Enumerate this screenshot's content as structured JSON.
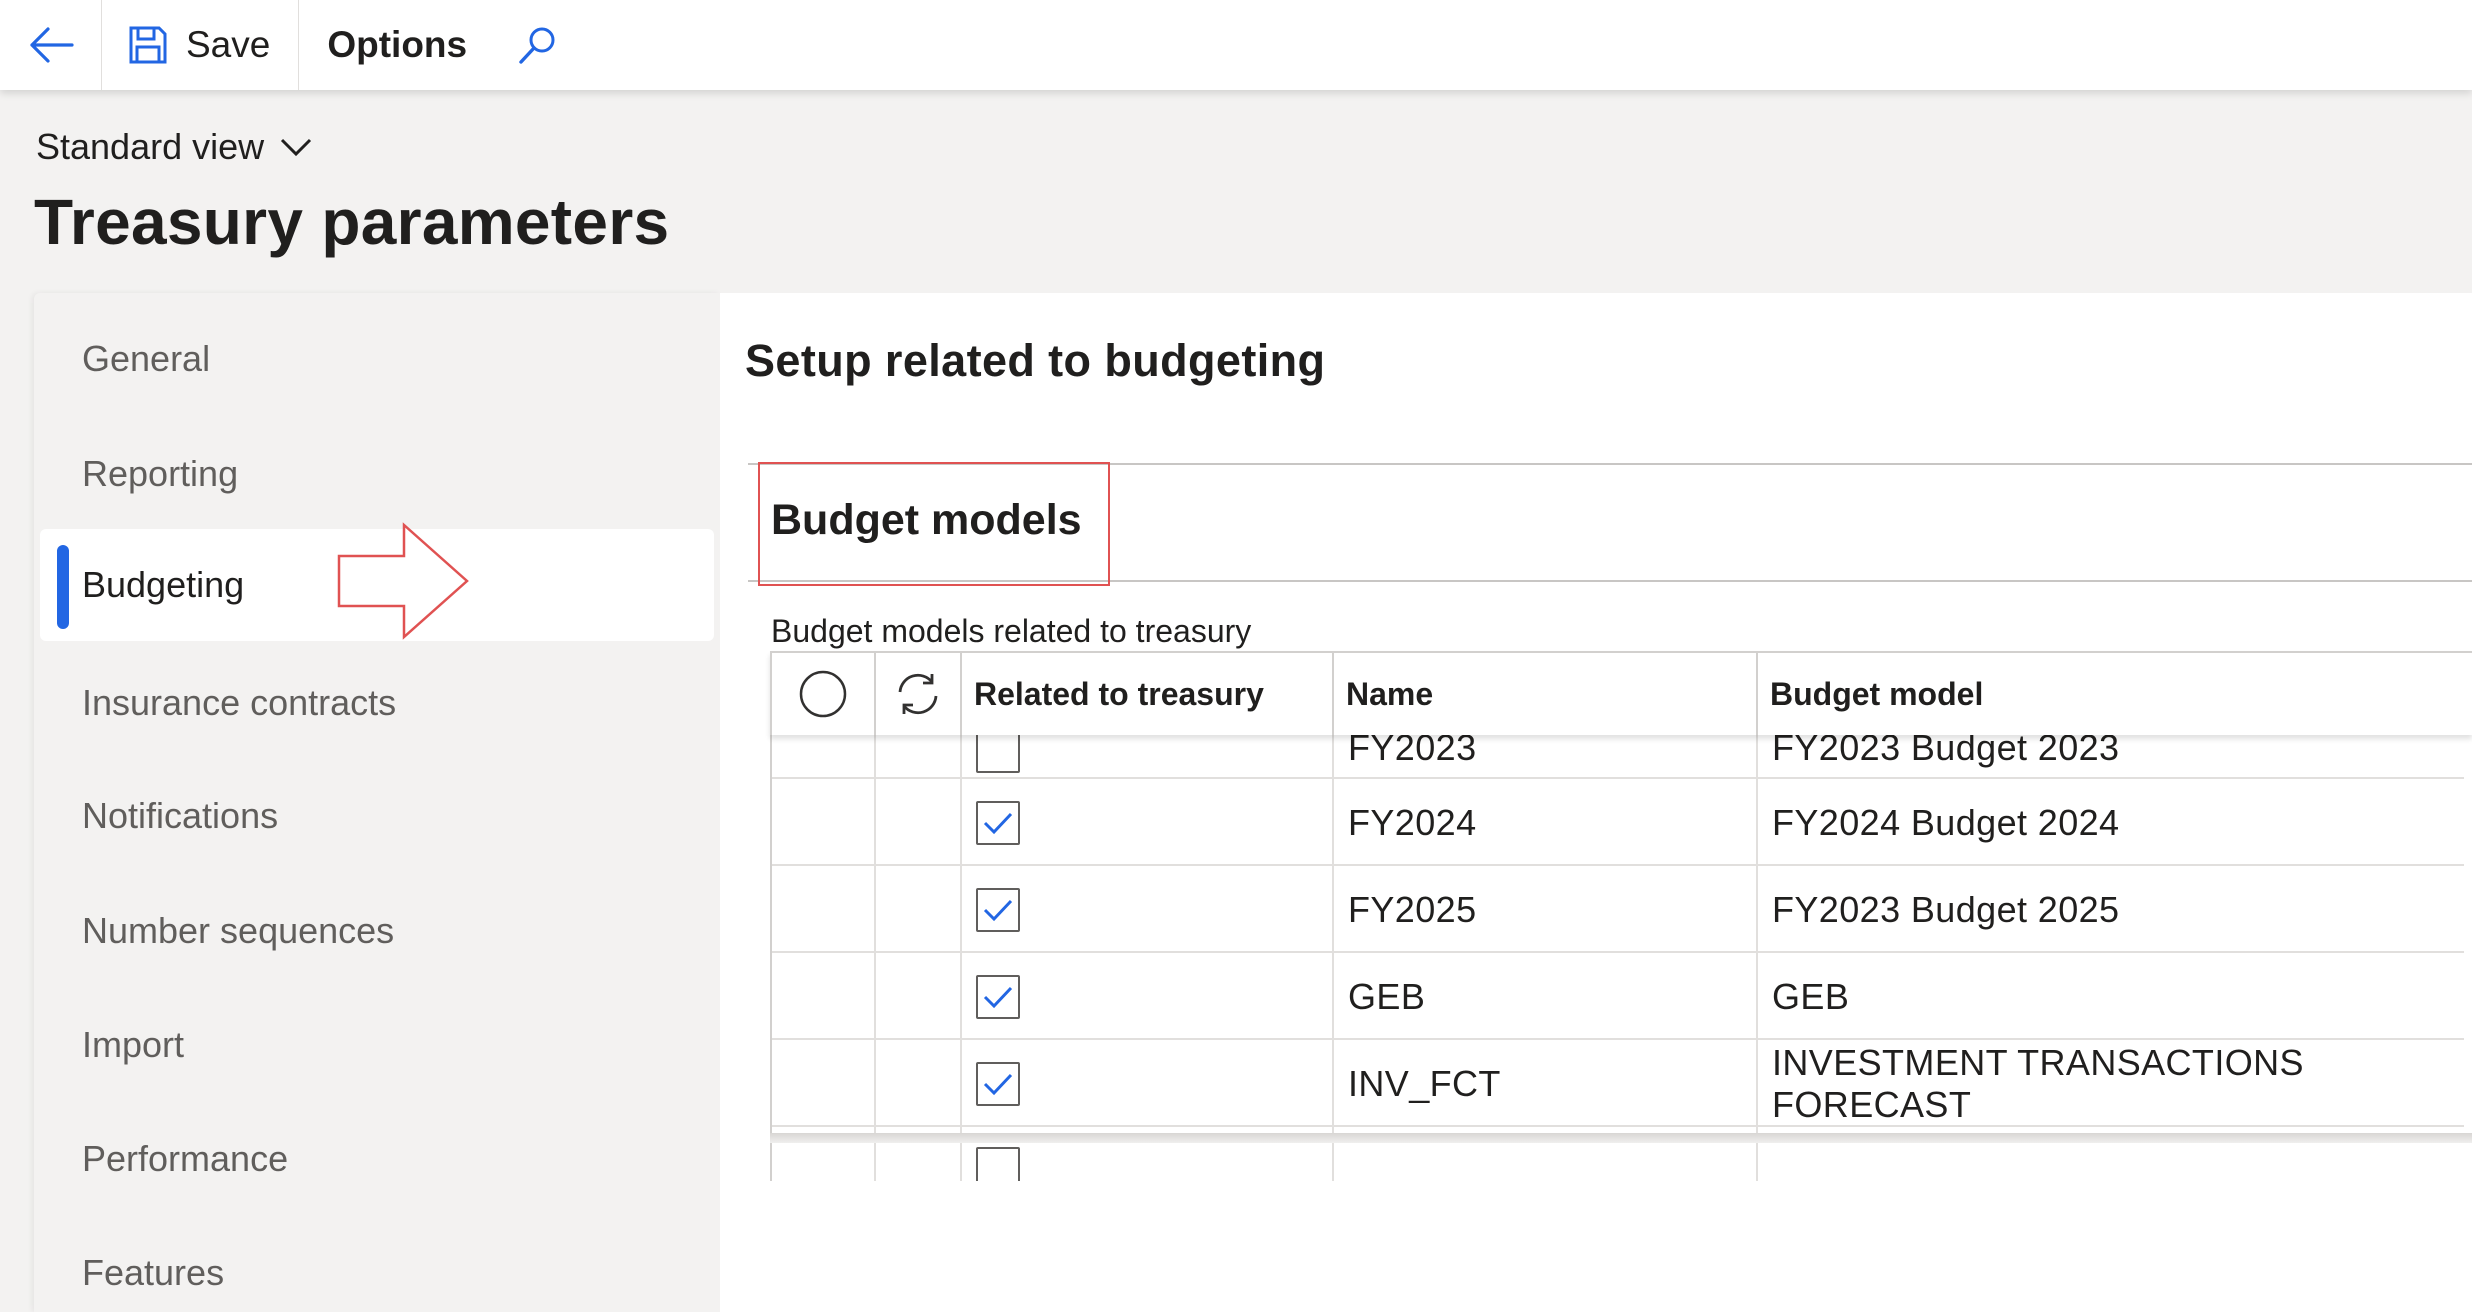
{
  "toolbar": {
    "save_label": "Save",
    "options_label": "Options"
  },
  "header": {
    "view_label": "Standard view",
    "page_title": "Treasury parameters"
  },
  "nav": {
    "items": [
      {
        "label": "General"
      },
      {
        "label": "Reporting"
      },
      {
        "label": "Budgeting",
        "active": true
      },
      {
        "label": "Insurance contracts"
      },
      {
        "label": "Notifications"
      },
      {
        "label": "Number sequences"
      },
      {
        "label": "Import"
      },
      {
        "label": "Performance"
      },
      {
        "label": "Features"
      }
    ]
  },
  "main": {
    "section_title": "Setup related to budgeting",
    "fasttab_title": "Budget models",
    "grid_label": "Budget models related to treasury",
    "grid": {
      "columns": [
        "Related to treasury",
        "Name",
        "Budget model"
      ],
      "rows": [
        {
          "related": false,
          "name": "FY2023",
          "budget_model": "FY2023 Budget 2023"
        },
        {
          "related": true,
          "name": "FY2024",
          "budget_model": "FY2024 Budget 2024"
        },
        {
          "related": true,
          "name": "FY2025",
          "budget_model": "FY2023 Budget 2025"
        },
        {
          "related": true,
          "name": "GEB",
          "budget_model": "GEB"
        },
        {
          "related": true,
          "name": "INV_FCT",
          "budget_model": "INVESTMENT TRANSACTIONS FORECAST"
        }
      ]
    }
  },
  "colors": {
    "accent": "#2266e3",
    "annotation_red": "#e05252",
    "nav_bg": "#f3f2f1"
  },
  "icons": [
    "back-arrow-icon",
    "save-icon",
    "search-icon",
    "chevron-down-icon",
    "select-all-circle-icon",
    "refresh-icon",
    "checkmark-icon",
    "red-arrow-annotation"
  ]
}
